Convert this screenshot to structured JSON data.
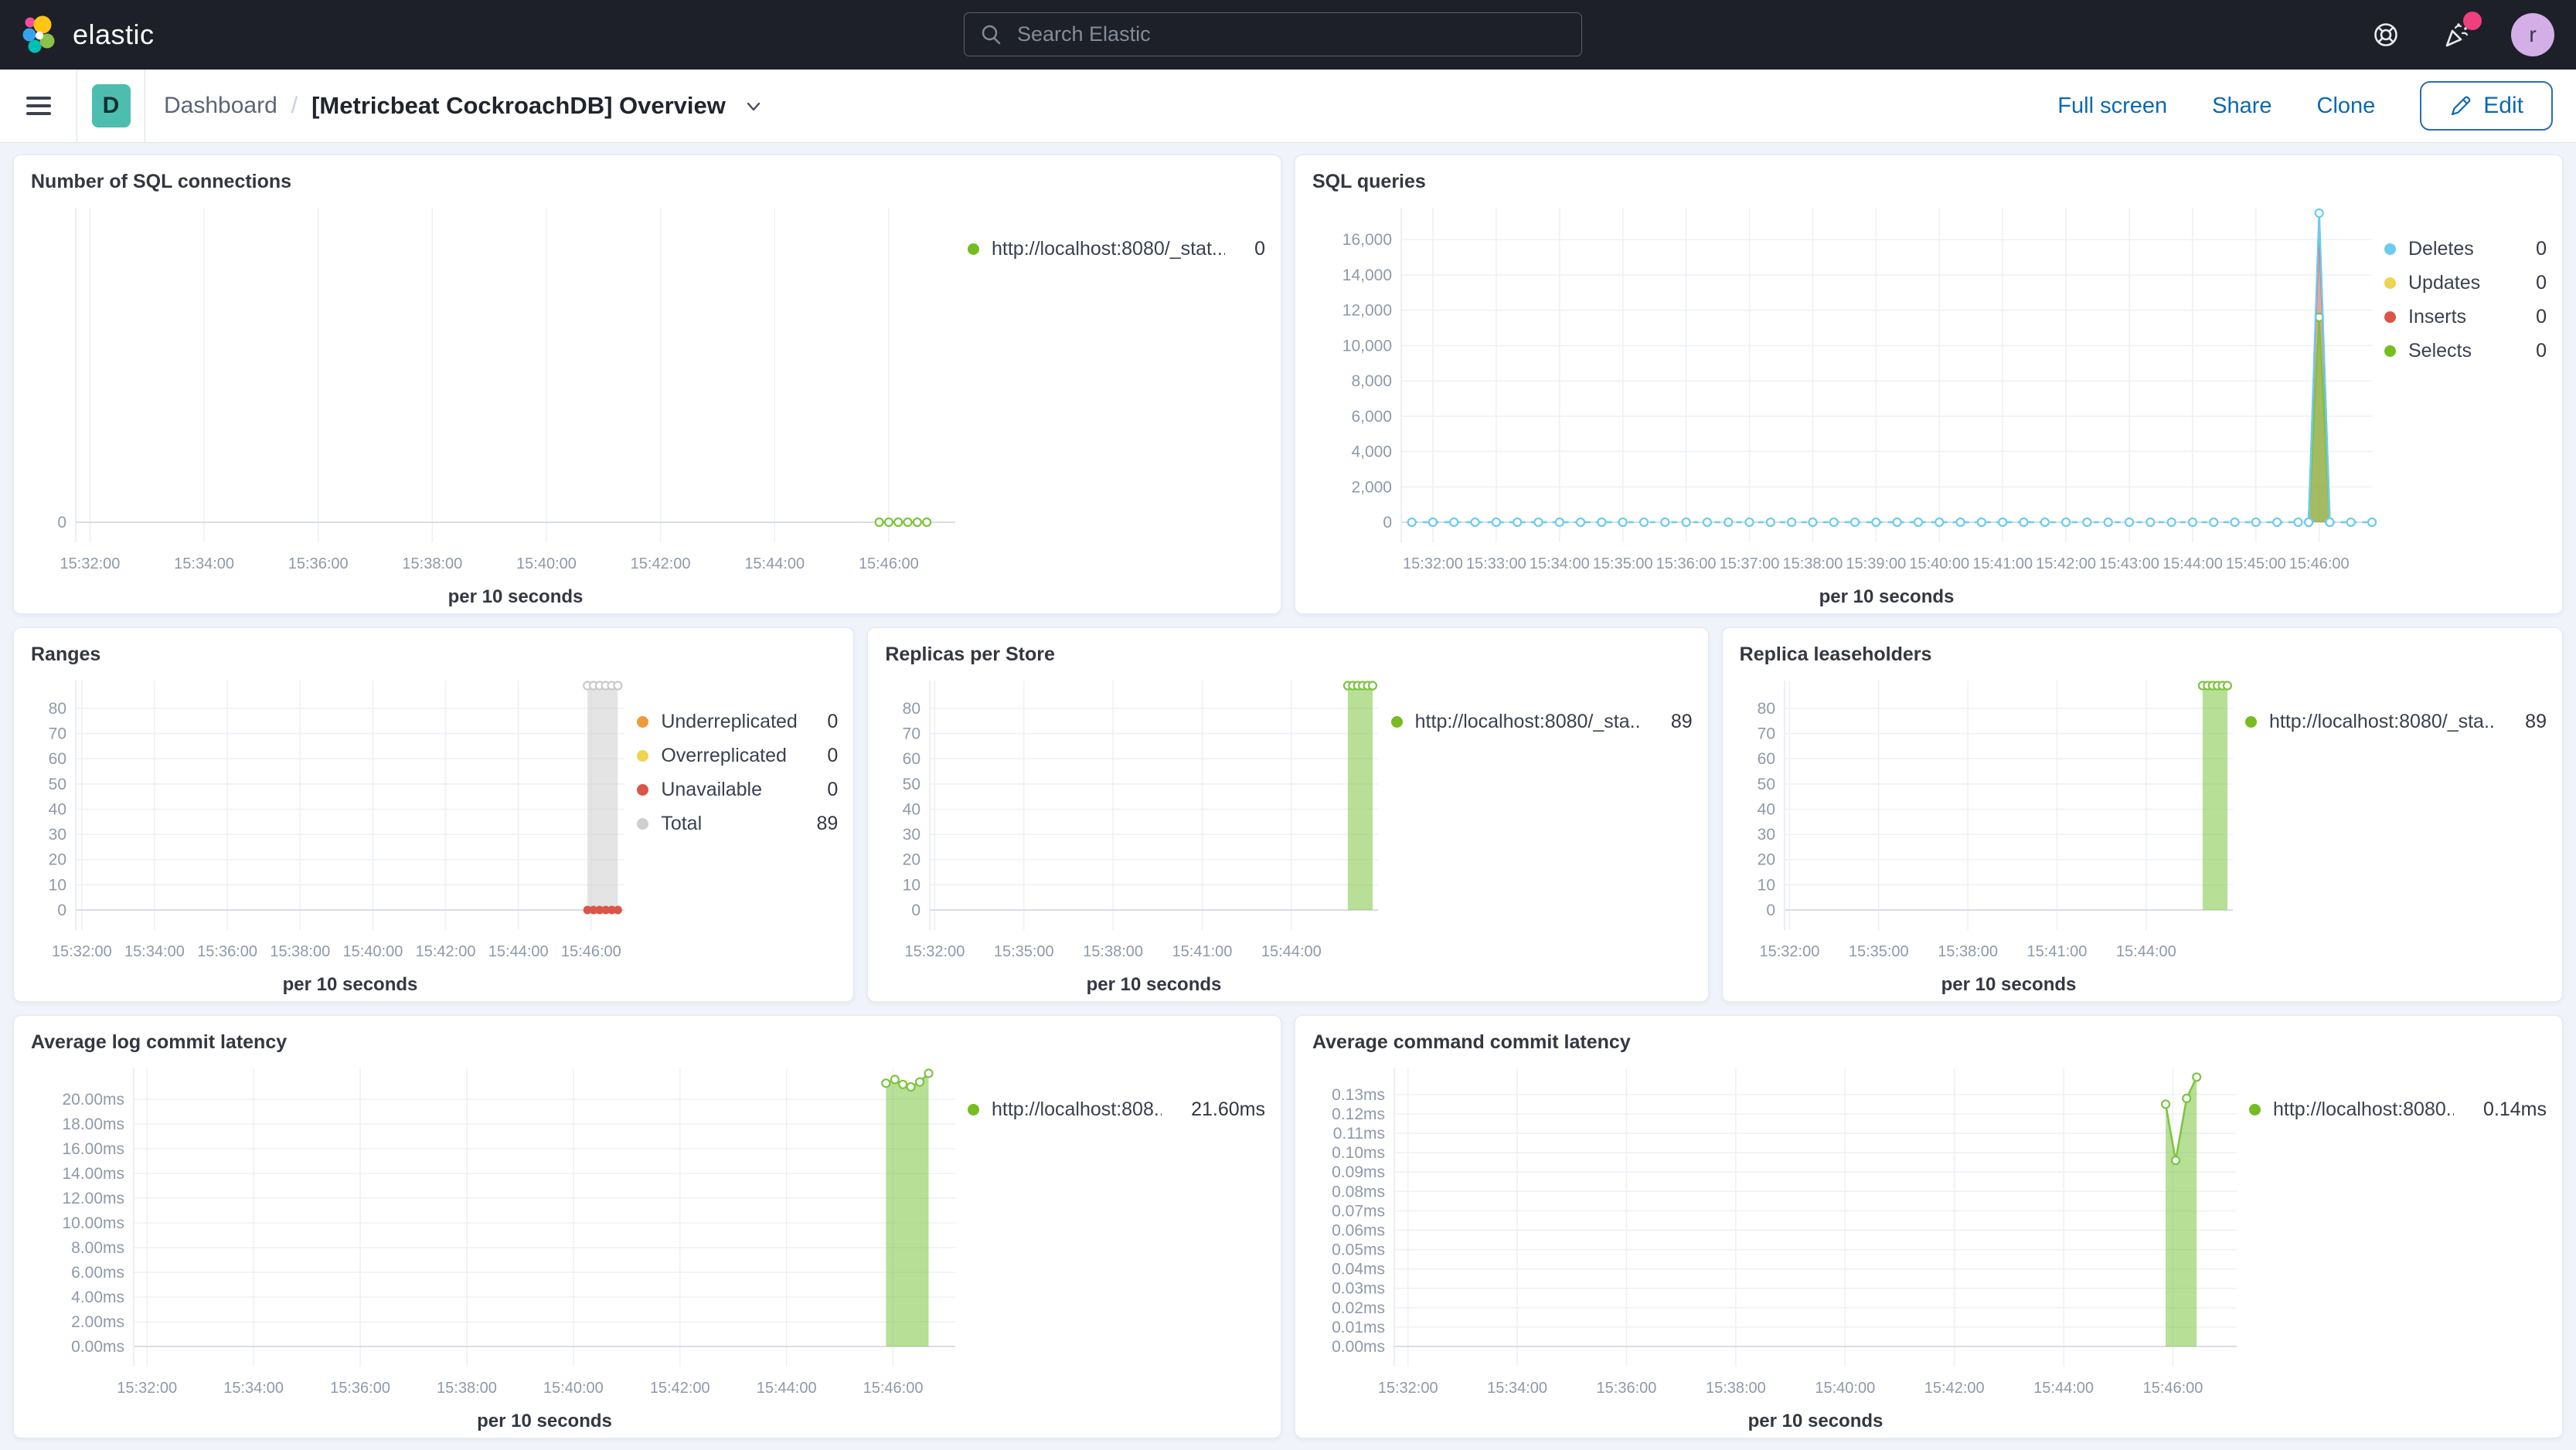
{
  "topbar": {
    "brand": "elastic",
    "search_placeholder": "Search Elastic",
    "avatar_letter": "r"
  },
  "toolbar": {
    "badge_letter": "D",
    "breadcrumb_root": "Dashboard",
    "breadcrumb_separator": "/",
    "title": "[Metricbeat CockroachDB] Overview",
    "actions": [
      "Full screen",
      "Share",
      "Clone"
    ],
    "edit_label": "Edit"
  },
  "colors": {
    "nav_bg": "#1d2029",
    "link_blue": "#0b69b0",
    "series_green": "#7CC43F",
    "series_blue": "#6DCBEE",
    "series_red": "#DB5648",
    "series_yellow": "#F0D44F",
    "series_orange": "#EE9A3B",
    "series_gray": "#CFCFCF",
    "notification_pink": "#ef3f7d",
    "badge_teal": "#4dbdb0"
  },
  "panels": [
    {
      "id": "sql-connections",
      "title": "Number of SQL connections",
      "legend": [
        {
          "label": "http://localhost:8080/_stat...",
          "value": "0",
          "color": "#77BC21"
        }
      ],
      "chart": {
        "type": "line",
        "x_axis_title": "per 10 seconds",
        "x_domain": [
          "15:31:45",
          "15:47:10"
        ],
        "x_ticks": [
          "15:32:00",
          "15:34:00",
          "15:36:00",
          "15:38:00",
          "15:40:00",
          "15:42:00",
          "15:44:00",
          "15:46:00"
        ],
        "y_ticks": [
          0
        ],
        "y_tick_labels": [
          "0"
        ],
        "y_max": 10,
        "margin_left": 60,
        "series": [
          {
            "label": "connections",
            "type": "line",
            "color": "#7CC43F",
            "dash": true,
            "markers": "hollow",
            "segment": {
              "from": "15:45:50",
              "to": "15:46:40",
              "y": 0,
              "step_s": 10
            }
          }
        ]
      }
    },
    {
      "id": "sql-queries",
      "title": "SQL queries",
      "legend": [
        {
          "label": "Deletes",
          "value": "0",
          "color": "#6DCBEE"
        },
        {
          "label": "Updates",
          "value": "0",
          "color": "#F0D44F"
        },
        {
          "label": "Inserts",
          "value": "0",
          "color": "#DB5648"
        },
        {
          "label": "Selects",
          "value": "0",
          "color": "#77BC21"
        }
      ],
      "chart": {
        "type": "line",
        "x_axis_title": "per 10 seconds",
        "x_domain": [
          "15:31:30",
          "15:46:50"
        ],
        "x_ticks": [
          "15:32:00",
          "15:33:00",
          "15:34:00",
          "15:35:00",
          "15:36:00",
          "15:37:00",
          "15:38:00",
          "15:39:00",
          "15:40:00",
          "15:41:00",
          "15:42:00",
          "15:43:00",
          "15:44:00",
          "15:45:00",
          "15:46:00"
        ],
        "y_ticks": [
          0,
          2000,
          4000,
          6000,
          8000,
          10000,
          12000,
          14000,
          16000
        ],
        "y_tick_labels": [
          "0",
          "2,000",
          "4,000",
          "6,000",
          "8,000",
          "10,000",
          "12,000",
          "14,000",
          "16,000"
        ],
        "y_max": 17800,
        "margin_left": 117,
        "series": [
          {
            "label": "Inserts",
            "type": "area",
            "color": "#DB5648",
            "fill_opacity": 0.5,
            "markers": "none",
            "points": [
              [
                "15:45:50",
                0
              ],
              [
                "15:46:00",
                16900
              ],
              [
                "15:46:10",
                0
              ]
            ]
          },
          {
            "label": "Selects",
            "type": "area",
            "color": "#7CC43F",
            "fill_opacity": 0.65,
            "markers": "hollow",
            "points": [
              [
                "15:45:50",
                0
              ],
              [
                "15:46:00",
                11600
              ],
              [
                "15:46:10",
                0
              ]
            ]
          },
          {
            "label": "Deletes-baseline-left",
            "type": "line",
            "color": "#6DCBEE",
            "dash": true,
            "markers": "hollow",
            "segment": {
              "from": "15:31:40",
              "to": "15:45:40",
              "y": 0,
              "step_s": 20
            }
          },
          {
            "label": "Deletes-spike",
            "type": "line",
            "color": "#6DCBEE",
            "markers": "hollow",
            "points": [
              [
                "15:45:50",
                0
              ],
              [
                "15:46:00",
                17500
              ],
              [
                "15:46:10",
                0
              ]
            ]
          },
          {
            "label": "Deletes-baseline-right",
            "type": "line",
            "color": "#6DCBEE",
            "dash": true,
            "markers": "hollow",
            "segment": {
              "from": "15:46:10",
              "to": "15:46:50",
              "y": 0,
              "step_s": 20
            }
          }
        ]
      }
    },
    {
      "id": "ranges",
      "title": "Ranges",
      "legend": [
        {
          "label": "Underreplicated",
          "value": "0",
          "color": "#EE9A3B"
        },
        {
          "label": "Overreplicated",
          "value": "0",
          "color": "#F0D44F"
        },
        {
          "label": "Unavailable",
          "value": "0",
          "color": "#DB5648"
        },
        {
          "label": "Total",
          "value": "89",
          "color": "#CFCFCF"
        }
      ],
      "chart": {
        "type": "area",
        "x_axis_title": "per 10 seconds",
        "x_domain": [
          "15:31:50",
          "15:46:55"
        ],
        "x_ticks": [
          "15:32:00",
          "15:34:00",
          "15:36:00",
          "15:38:00",
          "15:40:00",
          "15:42:00",
          "15:44:00",
          "15:46:00"
        ],
        "y_ticks": [
          0,
          10,
          20,
          30,
          40,
          50,
          60,
          70,
          80
        ],
        "y_tick_labels": [
          "0",
          "10",
          "20",
          "30",
          "40",
          "50",
          "60",
          "70",
          "80"
        ],
        "y_max": 91,
        "margin_left": 60,
        "series": [
          {
            "label": "Total",
            "type": "area",
            "color": "#C9C9C9",
            "fill_opacity": 0.5,
            "markers": "hollow",
            "segment": {
              "from": "15:45:54",
              "to": "15:46:44",
              "y": 89,
              "step_s": 10
            }
          },
          {
            "label": "Unavailable",
            "type": "line",
            "color": "#DB5648",
            "width": 3,
            "markers": "solid",
            "segment": {
              "from": "15:45:54",
              "to": "15:46:44",
              "y": 0,
              "step_s": 10
            }
          }
        ]
      }
    },
    {
      "id": "replicas-per-store",
      "title": "Replicas per Store",
      "legend": [
        {
          "label": "http://localhost:8080/_sta...",
          "value": "89",
          "color": "#77BC21"
        }
      ],
      "chart": {
        "type": "area",
        "x_axis_title": "per 10 seconds",
        "x_domain": [
          "15:31:50",
          "15:46:55"
        ],
        "x_ticks": [
          "15:32:00",
          "15:35:00",
          "15:38:00",
          "15:41:00",
          "15:44:00"
        ],
        "y_ticks": [
          0,
          10,
          20,
          30,
          40,
          50,
          60,
          70,
          80
        ],
        "y_tick_labels": [
          "0",
          "10",
          "20",
          "30",
          "40",
          "50",
          "60",
          "70",
          "80"
        ],
        "y_max": 91,
        "margin_left": 60,
        "series": [
          {
            "label": "replicas",
            "type": "area",
            "color": "#7CC43F",
            "fill_opacity": 0.55,
            "markers": "hollow",
            "segment": {
              "from": "15:45:54",
              "to": "15:46:44",
              "y": 89,
              "step_s": 10
            }
          }
        ]
      }
    },
    {
      "id": "replica-leaseholders",
      "title": "Replica leaseholders",
      "legend": [
        {
          "label": "http://localhost:8080/_sta...",
          "value": "89",
          "color": "#77BC21"
        }
      ],
      "chart": {
        "type": "area",
        "x_axis_title": "per 10 seconds",
        "x_domain": [
          "15:31:50",
          "15:46:55"
        ],
        "x_ticks": [
          "15:32:00",
          "15:35:00",
          "15:38:00",
          "15:41:00",
          "15:44:00"
        ],
        "y_ticks": [
          0,
          10,
          20,
          30,
          40,
          50,
          60,
          70,
          80
        ],
        "y_tick_labels": [
          "0",
          "10",
          "20",
          "30",
          "40",
          "50",
          "60",
          "70",
          "80"
        ],
        "y_max": 91,
        "margin_left": 60,
        "series": [
          {
            "label": "leaseholders",
            "type": "area",
            "color": "#7CC43F",
            "fill_opacity": 0.55,
            "markers": "hollow",
            "segment": {
              "from": "15:45:54",
              "to": "15:46:44",
              "y": 89,
              "step_s": 10
            }
          }
        ]
      }
    },
    {
      "id": "avg-log-commit-latency",
      "title": "Average log commit latency",
      "legend": [
        {
          "label": "http://localhost:808...",
          "value": "21.60ms",
          "color": "#77BC21"
        }
      ],
      "chart": {
        "type": "area",
        "x_axis_title": "per 10 seconds",
        "x_domain": [
          "15:31:45",
          "15:47:10"
        ],
        "x_ticks": [
          "15:32:00",
          "15:34:00",
          "15:36:00",
          "15:38:00",
          "15:40:00",
          "15:42:00",
          "15:44:00",
          "15:46:00"
        ],
        "y_ticks": [
          0,
          2,
          4,
          6,
          8,
          10,
          12,
          14,
          16,
          18,
          20
        ],
        "y_tick_labels": [
          "0.00ms",
          "2.00ms",
          "4.00ms",
          "6.00ms",
          "8.00ms",
          "10.00ms",
          "12.00ms",
          "14.00ms",
          "16.00ms",
          "18.00ms",
          "20.00ms"
        ],
        "y_max": 22.5,
        "margin_left": 135,
        "series": [
          {
            "label": "log-commit-latency",
            "type": "area",
            "color": "#7CC43F",
            "fill_opacity": 0.55,
            "markers": "hollow",
            "points": [
              [
                "15:45:52",
                21.3
              ],
              [
                "15:46:02",
                21.6
              ],
              [
                "15:46:11",
                21.2
              ],
              [
                "15:46:20",
                21.0
              ],
              [
                "15:46:30",
                21.4
              ],
              [
                "15:46:40",
                22.1
              ]
            ]
          }
        ]
      }
    },
    {
      "id": "avg-command-commit-latency",
      "title": "Average command commit latency",
      "legend": [
        {
          "label": "http://localhost:8080...",
          "value": "0.14ms",
          "color": "#77BC21"
        }
      ],
      "chart": {
        "type": "area",
        "x_axis_title": "per 10 seconds",
        "x_domain": [
          "15:31:45",
          "15:47:10"
        ],
        "x_ticks": [
          "15:32:00",
          "15:34:00",
          "15:36:00",
          "15:38:00",
          "15:40:00",
          "15:42:00",
          "15:44:00",
          "15:46:00"
        ],
        "y_ticks": [
          0,
          0.01,
          0.02,
          0.03,
          0.04,
          0.05,
          0.06,
          0.07,
          0.08,
          0.09,
          0.1,
          0.11,
          0.12,
          0.13
        ],
        "y_tick_labels": [
          "0.00ms",
          "0.01ms",
          "0.02ms",
          "0.03ms",
          "0.04ms",
          "0.05ms",
          "0.06ms",
          "0.07ms",
          "0.08ms",
          "0.09ms",
          "0.10ms",
          "0.11ms",
          "0.12ms",
          "0.13ms"
        ],
        "y_max": 0.1435,
        "margin_left": 108,
        "series": [
          {
            "label": "command-commit-latency",
            "type": "area",
            "color": "#7CC43F",
            "fill_opacity": 0.55,
            "markers": "hollow",
            "points": [
              [
                "15:45:52",
                0.125
              ],
              [
                "15:46:03",
                0.096
              ],
              [
                "15:46:15",
                0.128
              ],
              [
                "15:46:26",
                0.139
              ]
            ]
          }
        ]
      }
    }
  ]
}
